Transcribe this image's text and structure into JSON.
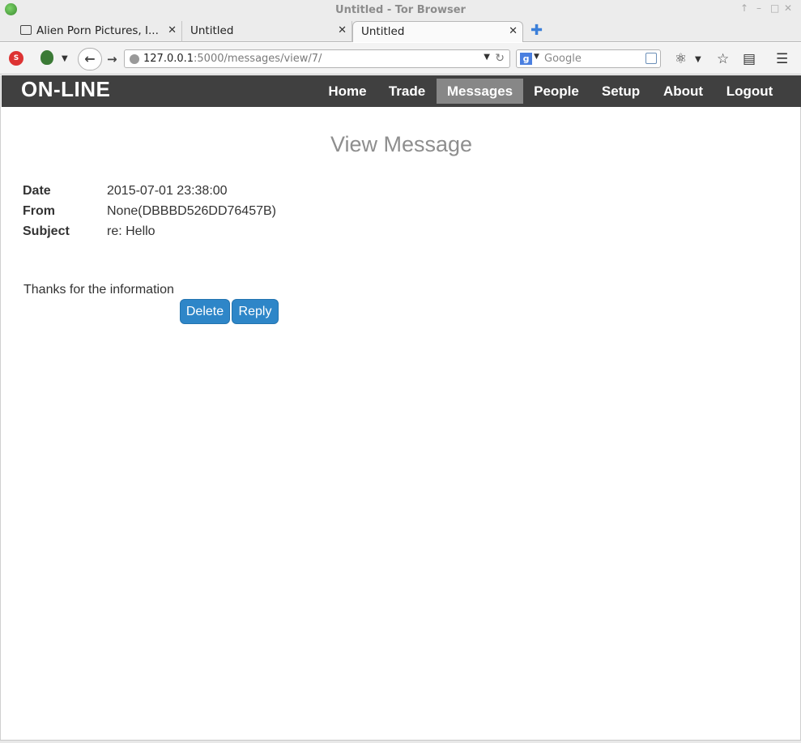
{
  "window": {
    "title": "Untitled - Tor Browser",
    "controls": [
      "↑",
      "–",
      "□",
      "✕"
    ]
  },
  "tabs": [
    {
      "label": "Alien Porn Pictures, I...",
      "active": false
    },
    {
      "label": "Untitled",
      "active": false
    },
    {
      "label": "Untitled",
      "active": true
    }
  ],
  "toolbar": {
    "url_host": "127.0.0.1",
    "url_rest": ":5000/messages/view/7/",
    "search_placeholder": "Google",
    "search_engine": "g"
  },
  "site": {
    "brand": "ON-LINE",
    "menu": [
      {
        "label": "Home",
        "active": false
      },
      {
        "label": "Trade",
        "active": false
      },
      {
        "label": "Messages",
        "active": true
      },
      {
        "label": "People",
        "active": false
      },
      {
        "label": "Setup",
        "active": false
      },
      {
        "label": "About",
        "active": false
      },
      {
        "label": "Logout",
        "active": false
      }
    ]
  },
  "message": {
    "heading": "View Message",
    "fields": [
      {
        "label": "Date",
        "value": "2015-07-01 23:38:00"
      },
      {
        "label": "From",
        "value": "None(DBBBD526DD76457B)"
      },
      {
        "label": "Subject",
        "value": "re: Hello"
      }
    ],
    "body": "Thanks for the information",
    "delete_label": "Delete",
    "reply_label": "Reply"
  },
  "colors": {
    "nav_bg": "#404040",
    "nav_active": "#878787",
    "button": "#2e86c8",
    "heading": "#8e8e8e"
  }
}
